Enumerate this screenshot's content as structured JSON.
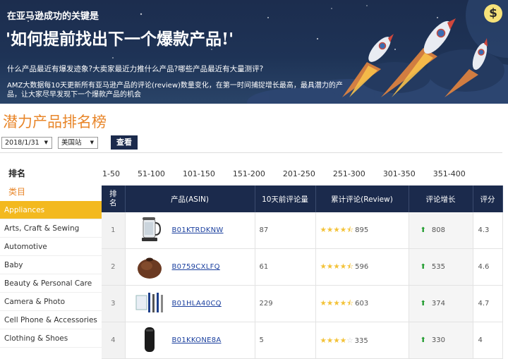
{
  "banner": {
    "kicker": "在亚马逊成功的关键是",
    "headline": "'如何提前找出下一个爆款产品!'",
    "questions": "什么产品最近有爆发迹象?大卖家最近力推什么产品?哪些产品最近有大量测评?",
    "description": "AMZ大数据每10天更新所有亚马逊产品的评论(review)数量变化，在第一时间捕捉增长最高，最具潜力的产品，让大家尽早发现下一个爆款产品的机会",
    "dollar_symbol": "$"
  },
  "page_title": "潜力产品排名榜",
  "controls": {
    "date_value": "2018/1/31",
    "site_value": "美国站",
    "view_label": "查看"
  },
  "sidebar": {
    "ranking_label": "排名",
    "category_label": "类目",
    "items": [
      {
        "label": "Appliances",
        "active": true
      },
      {
        "label": "Arts, Craft & Sewing",
        "active": false
      },
      {
        "label": "Automotive",
        "active": false
      },
      {
        "label": "Baby",
        "active": false
      },
      {
        "label": "Beauty & Personal Care",
        "active": false
      },
      {
        "label": "Camera & Photo",
        "active": false
      },
      {
        "label": "Cell Phone & Accessories",
        "active": false
      },
      {
        "label": "Clothing & Shoes",
        "active": false
      }
    ]
  },
  "pager": [
    "1-50",
    "51-100",
    "101-150",
    "151-200",
    "201-250",
    "251-300",
    "301-350",
    "351-400"
  ],
  "table": {
    "headers": {
      "rank": "排名",
      "product": "产品(ASIN)",
      "prev_reviews": "10天前评论量",
      "total_reviews": "累计评论(Review)",
      "growth": "评论增长",
      "score": "评分"
    },
    "rows": [
      {
        "rank": "1",
        "asin": "B01KTRDKNW",
        "prev": "87",
        "stars": 4.5,
        "total": "895",
        "growth": "808",
        "score": "4.3",
        "thumb": "kettle"
      },
      {
        "rank": "2",
        "asin": "B0759CXLFQ",
        "prev": "61",
        "stars": 4.5,
        "total": "596",
        "growth": "535",
        "score": "4.6",
        "thumb": "diffuser"
      },
      {
        "rank": "3",
        "asin": "B01HLA40CQ",
        "prev": "229",
        "stars": 4.5,
        "total": "603",
        "growth": "374",
        "score": "4.7",
        "thumb": "brushes"
      },
      {
        "rank": "4",
        "asin": "B01KKONE8A",
        "prev": "5",
        "stars": 4,
        "total": "335",
        "growth": "330",
        "score": "4",
        "thumb": "cylinder"
      }
    ]
  },
  "colors": {
    "banner_bg": "#1e3356",
    "accent_orange": "#e8862a",
    "active_yellow": "#f3b91f",
    "header_navy": "#1b2a4c",
    "link_blue": "#1a3f9e",
    "growth_green": "#1f9b2d",
    "star_gold": "#f3c237"
  },
  "icons": {
    "up_arrow": "up-arrow-icon",
    "star": "star-icon",
    "dropdown": "dropdown-arrow-icon",
    "rocket": "rocket-icon",
    "dollar": "dollar-coin-icon"
  }
}
